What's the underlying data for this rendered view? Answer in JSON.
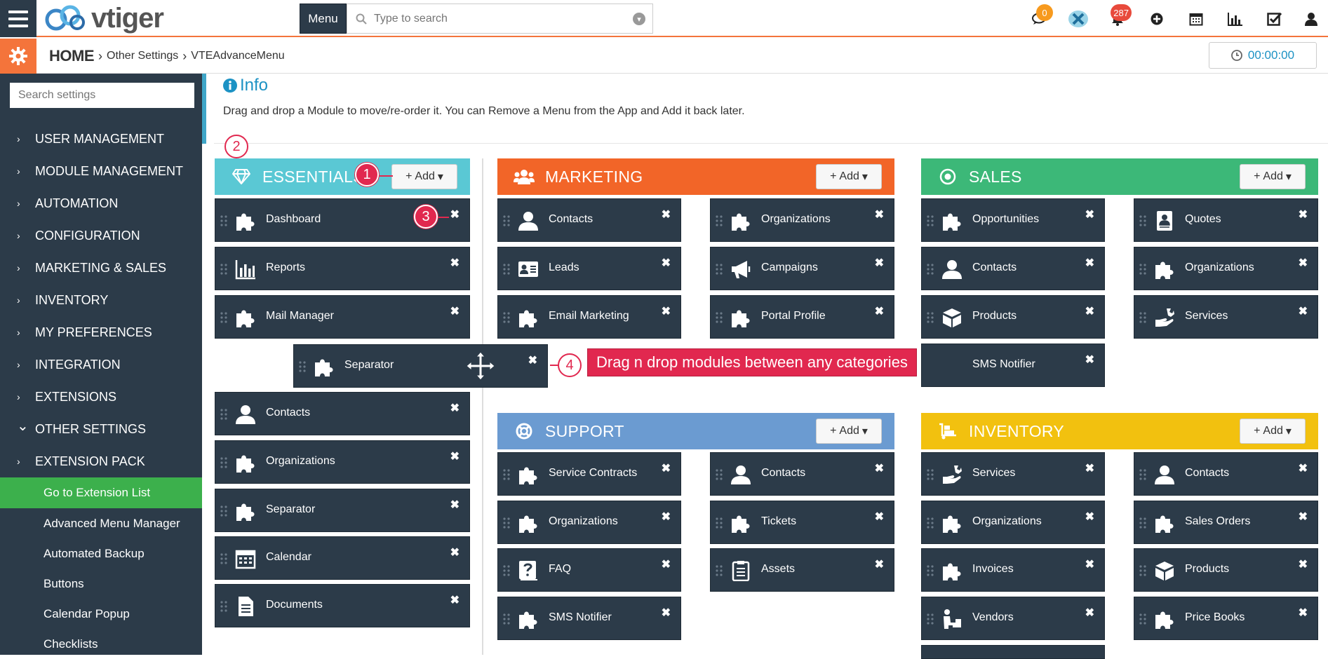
{
  "topbar": {
    "logo_text": "vtiger",
    "menu_label": "Menu",
    "search_placeholder": "Type to search",
    "chat_badge": "0",
    "notify_badge": "287"
  },
  "subbar": {
    "home": "HOME",
    "crumbs": [
      "Other Settings",
      "VTEAdvanceMenu"
    ],
    "timer": "00:00:00"
  },
  "sidebar": {
    "search_placeholder": "Search settings",
    "items": [
      {
        "label": "USER MANAGEMENT",
        "chev": "›"
      },
      {
        "label": "MODULE MANAGEMENT",
        "chev": "›"
      },
      {
        "label": "AUTOMATION",
        "chev": "›"
      },
      {
        "label": "CONFIGURATION",
        "chev": "›"
      },
      {
        "label": "MARKETING & SALES",
        "chev": "›"
      },
      {
        "label": "INVENTORY",
        "chev": "›"
      },
      {
        "label": "MY PREFERENCES",
        "chev": "›"
      },
      {
        "label": "INTEGRATION",
        "chev": "›"
      },
      {
        "label": "EXTENSIONS",
        "chev": "›"
      },
      {
        "label": "OTHER SETTINGS",
        "chev": "⌄"
      },
      {
        "label": "EXTENSION PACK",
        "chev": "›"
      }
    ],
    "subitems": [
      "Go to Extension List",
      "Advanced Menu Manager",
      "Automated Backup",
      "Buttons",
      "Calendar Popup",
      "Checklists"
    ]
  },
  "main": {
    "info_title": "Info",
    "info_text": "Drag and drop a Module to move/re-order it. You can Remove a Menu from the App and Add it back later.",
    "add_label": "Add",
    "callout": "Drag n drop modules between any categories",
    "markers": [
      "1",
      "2",
      "3",
      "4"
    ]
  },
  "categories": {
    "essentials": {
      "name": "ESSENTIALS",
      "color": "#5ac8d4",
      "col1": [
        "Dashboard",
        "Reports",
        "Mail Manager",
        "Contacts",
        "Organizations",
        "Separator",
        "Calendar",
        "Documents"
      ]
    },
    "dragged": {
      "label": "Separator"
    },
    "marketing": {
      "name": "MARKETING",
      "color": "#f26528",
      "col1": [
        "Contacts",
        "Leads",
        "Email Marketing"
      ],
      "col2": [
        "Organizations",
        "Campaigns",
        "Portal Profile"
      ]
    },
    "sales": {
      "name": "SALES",
      "color": "#3cb878",
      "col1": [
        "Opportunities",
        "Contacts",
        "Products",
        "SMS Notifier"
      ],
      "col2": [
        "Quotes",
        "Organizations",
        "Services"
      ]
    },
    "support": {
      "name": "SUPPORT",
      "color": "#6b9bd1",
      "col1": [
        "Service Contracts",
        "Organizations",
        "FAQ",
        "SMS Notifier"
      ],
      "col2": [
        "Contacts",
        "Tickets",
        "Assets"
      ]
    },
    "inventory": {
      "name": "INVENTORY",
      "color": "#f2c10f",
      "col1": [
        "Services",
        "Organizations",
        "Invoices",
        "Vendors"
      ],
      "col2": [
        "Contacts",
        "Sales Orders",
        "Products",
        "Price Books"
      ]
    }
  }
}
